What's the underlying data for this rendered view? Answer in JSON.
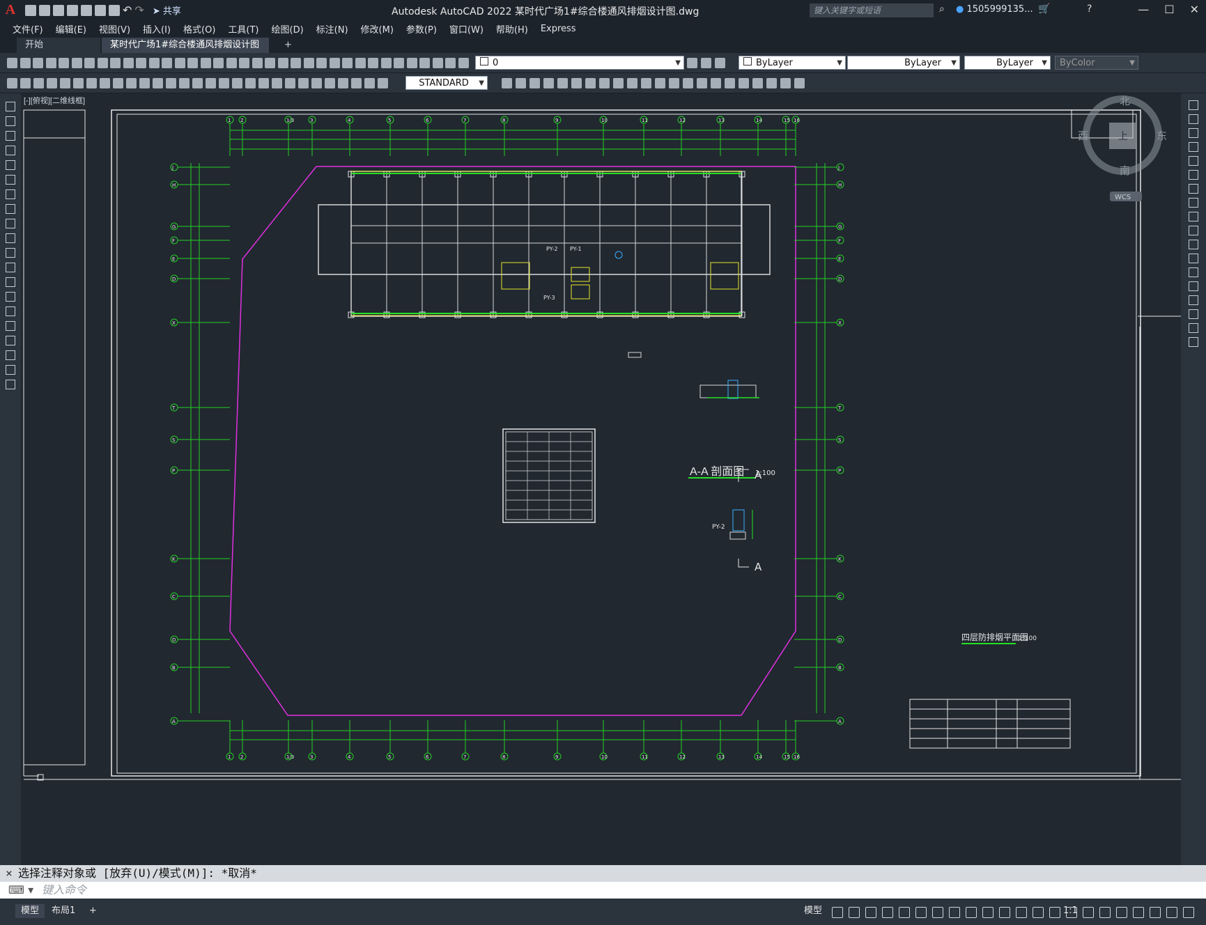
{
  "app": {
    "title": "Autodesk AutoCAD 2022    某时代广场1#综合楼通风排烟设计图.dwg",
    "share_label": "共享",
    "search_placeholder": "键入关键字或短语",
    "user": "1505999135...",
    "logo": "A"
  },
  "menu": [
    "文件(F)",
    "编辑(E)",
    "视图(V)",
    "插入(I)",
    "格式(O)",
    "工具(T)",
    "绘图(D)",
    "标注(N)",
    "修改(M)",
    "参数(P)",
    "窗口(W)",
    "帮助(H)",
    "Express"
  ],
  "tabs": {
    "start": "开始",
    "doc": "某时代广场1#综合楼通风排烟设计图*",
    "close": "×",
    "add": "+"
  },
  "toolbar": {
    "layer_value": "0",
    "color_value": "ByLayer",
    "linetype_value": "ByLayer",
    "lineweight_value": "ByLayer",
    "plotstyle_value": "ByColor",
    "textstyle_value": "STANDARD"
  },
  "viewcube": {
    "north": "北",
    "south": "南",
    "east": "东",
    "west": "西",
    "top": "上",
    "wcs": "WCS"
  },
  "drawing": {
    "section_title": "A-A 剖面图",
    "section_scale": "1:100",
    "section_marker": "A",
    "plan_title": "四层防排烟平面图",
    "plan_scale": "1:100",
    "pipe_label_1": "PY-2",
    "pipe_label_2": "PY-1",
    "pipe_label_3": "PY-3",
    "pipe_label_4": "PY-2",
    "viewport_label": "[-][俯视][二维线框]",
    "axis_top": [
      "1",
      "2",
      "1/3",
      "3",
      "4",
      "5",
      "6",
      "7",
      "8",
      "9",
      "10",
      "11",
      "12",
      "13",
      "14",
      "15",
      "16"
    ],
    "axis_left": [
      "J",
      "H",
      "G",
      "F",
      "E",
      "D",
      "X",
      "T",
      "S",
      "P",
      "K",
      "C",
      "D",
      "B",
      "A"
    ]
  },
  "command": {
    "history": "选择注释对象或 [放弃(U)/模式(M)]: *取消*",
    "prompt": "键入命令"
  },
  "status": {
    "model_tab": "模型",
    "layout_tab": "布局1",
    "add": "+",
    "model_label": "模型",
    "scale": "1:1"
  }
}
